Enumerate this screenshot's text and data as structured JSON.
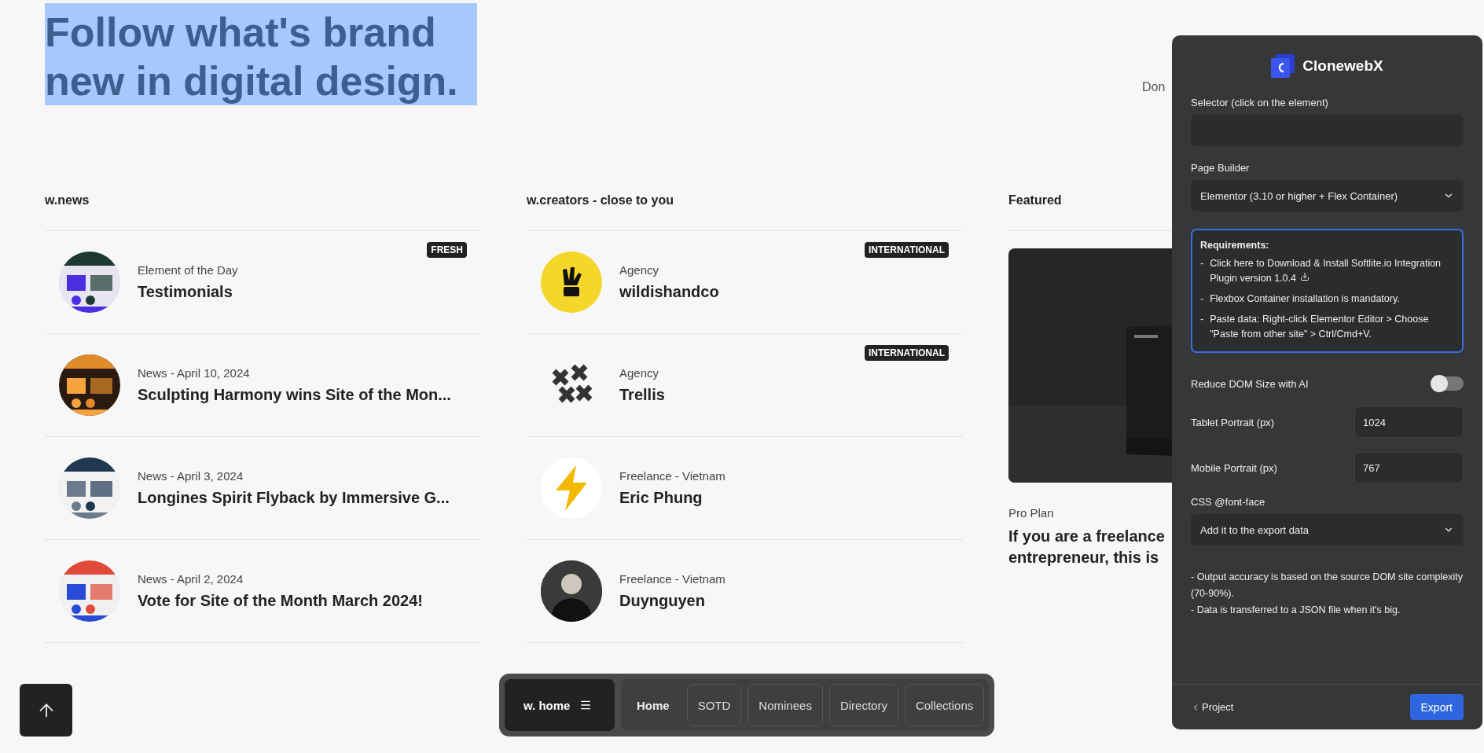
{
  "hero": {
    "headline": "Follow what's brand new in digital design.",
    "highlighted": true,
    "tagline": "Don"
  },
  "columns": [
    {
      "title": "w.news",
      "items": [
        {
          "meta": "Element of the Day",
          "title": "Testimonials",
          "badge": "FRESH"
        },
        {
          "meta": "News - April 10, 2024",
          "title": "Sculpting Harmony wins Site of the Mon..."
        },
        {
          "meta": "News - April 3, 2024",
          "title": "Longines Spirit Flyback by Immersive G..."
        },
        {
          "meta": "News - April 2, 2024",
          "title": "Vote for Site of the Month March 2024!"
        }
      ]
    },
    {
      "title": "w.creators - close to you",
      "items": [
        {
          "meta": "Agency",
          "title": "wildishandco",
          "badge": "INTERNATIONAL"
        },
        {
          "meta": "Agency",
          "title": "Trellis",
          "badge": "INTERNATIONAL"
        },
        {
          "meta": "Freelance - Vietnam",
          "title": "Eric Phung"
        },
        {
          "meta": "Freelance - Vietnam",
          "title": "Duynguyen"
        }
      ]
    },
    {
      "title": "Featured",
      "featured": {
        "kind": "picture",
        "category": "Pro Plan",
        "lines": [
          "If you are a freelance",
          "entrepreneur, this is"
        ]
      }
    }
  ],
  "nav": {
    "menu": "w. home",
    "links": [
      {
        "label": "Home",
        "selected": true
      },
      {
        "label": "SOTD",
        "selected": false
      },
      {
        "label": "Nominees",
        "selected": false
      },
      {
        "label": "Directory",
        "selected": false
      },
      {
        "label": "Collections",
        "selected": false
      }
    ]
  },
  "panel": {
    "brand": "ClonewebX",
    "selector": {
      "label": "Selector (click on the element)"
    },
    "page_builder": {
      "label": "Page Builder",
      "value": "Elementor (3.10 or higher + Flex Container)"
    },
    "requirements": {
      "title": "Requirements:",
      "items": [
        {
          "bullet": "-",
          "text": "Click here to Download & Install Softlite.io Integration Plugin version 1.0.4",
          "download": true
        },
        {
          "bullet": "-",
          "text": "Flexbox Container installation is mandatory.",
          "download": false
        },
        {
          "bullet": "-",
          "text": "Paste data: Right-click Elementor Editor > Choose \"Paste from other site\" > Ctrl/Cmd+V.",
          "download": false
        }
      ]
    },
    "reduce_dom": {
      "label": "Reduce DOM Size with AI",
      "on": false
    },
    "tablet": {
      "label": "Tablet Portrait (px)",
      "value": "1024"
    },
    "mobile": {
      "label": "Mobile Portrait (px)",
      "value": "767"
    },
    "font_face": {
      "label": "CSS @font-face",
      "value": "Add it to the export data"
    },
    "notes": [
      "- Output accuracy is based on the source DOM site complexity (70-90%).",
      "- Data is transferred to a JSON file when it's big."
    ],
    "back": "Project",
    "export": "Export"
  }
}
